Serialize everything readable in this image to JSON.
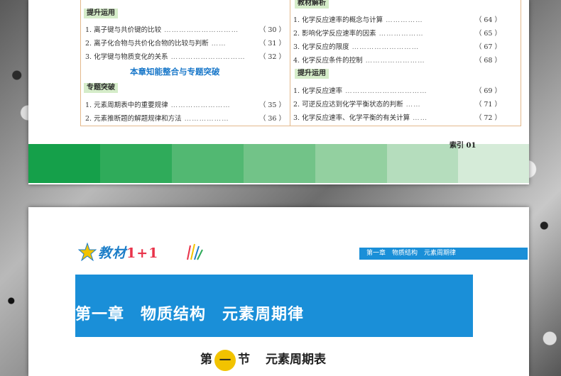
{
  "toc_left": {
    "top_cut_line": {
      "text": "",
      "page": ""
    },
    "section_apply": "提升运用",
    "apply_items": [
      {
        "text": "1. 离子键与共价键的比较",
        "page": "（ 30 ）"
      },
      {
        "text": "2. 离子化合物与共价化合物的比较与判断",
        "page": "（ 31 ）"
      },
      {
        "text": "3. 化学键与物质变化的关系",
        "page": "（ 32 ）"
      }
    ],
    "chapter_heading": "本章知能整合与专题突破",
    "section_special": "专题突破",
    "special_items": [
      {
        "text": "1. 元素周期表中的重要规律",
        "page": "（ 35 ）"
      },
      {
        "text": "2. 元素推断题的解题规律和方法",
        "page": "（ 36 ）"
      }
    ]
  },
  "toc_right": {
    "section_textbook": "教材解析",
    "textbook_items": [
      {
        "text": "1. 化学反应速率的概念与计算",
        "page": "（ 64 ）"
      },
      {
        "text": "2. 影响化学反应速率的因素",
        "page": "（ 65 ）"
      },
      {
        "text": "3. 化学反应的限度",
        "page": "（ 67 ）"
      },
      {
        "text": "4. 化学反应条件的控制",
        "page": "（ 68 ）"
      }
    ],
    "section_apply": "提升运用",
    "apply_items": [
      {
        "text": "1. 化学反应速率",
        "page": "（ 69 ）"
      },
      {
        "text": "2. 可逆反应达到化学平衡状态的判断",
        "page": "（ 71 ）"
      },
      {
        "text": "3. 化学反应速率、化学平衡的有关计算",
        "page": "（ 72 ）"
      }
    ]
  },
  "index_label": "索引 01",
  "stripe_colors": [
    "#15a04a",
    "#2fab5a",
    "#52b872",
    "#72c388",
    "#93d0a0",
    "#b5ddbd",
    "#d5ebd8"
  ],
  "logo": {
    "text": "教材",
    "accent": "1+1"
  },
  "header_bar": "第一章　物质结构　元素周期律",
  "chapter_title": "第一章　物质结构　元素周期律",
  "section": {
    "prefix": "第",
    "number": "一",
    "suffix": "节",
    "title": "元素周期表"
  }
}
